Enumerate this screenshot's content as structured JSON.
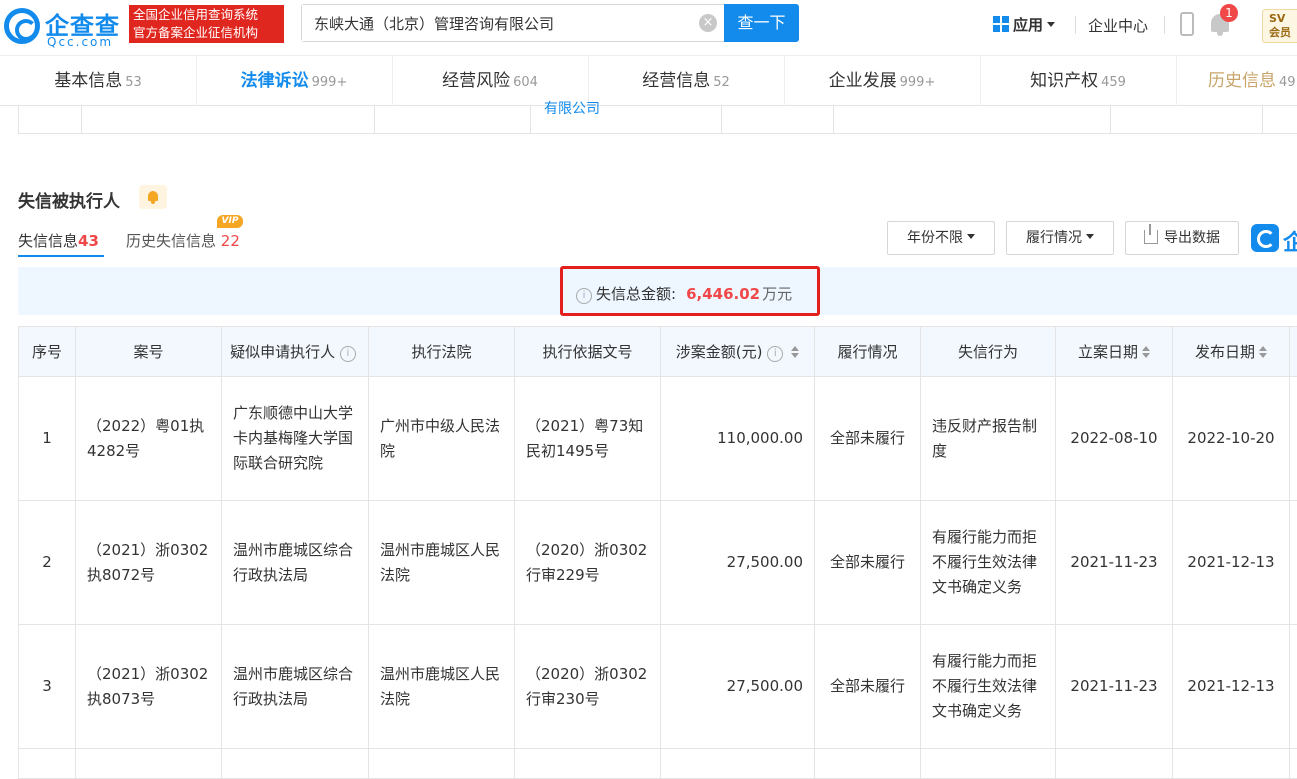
{
  "header": {
    "logo_cn": "企查查",
    "logo_en": "Qcc.com",
    "slogan_line1": "全国企业信用查询系统",
    "slogan_line2": "官方备案企业征信机构",
    "search_value": "东峡大通（北京）管理咨询有限公司",
    "search_button": "查一下",
    "app_label": "应用",
    "enterprise_center": "企业中心",
    "notification_count": "1",
    "vip_chip": "SV",
    "vip_chip_sub": "会员"
  },
  "tabs": [
    {
      "label": "基本信息",
      "count": "53"
    },
    {
      "label": "法律诉讼",
      "count": "999+"
    },
    {
      "label": "经营风险",
      "count": "604"
    },
    {
      "label": "经营信息",
      "count": "52"
    },
    {
      "label": "企业发展",
      "count": "999+"
    },
    {
      "label": "知识产权",
      "count": "459"
    },
    {
      "label": "历史信息",
      "count": "49"
    }
  ],
  "prev_table_text": "有限公司",
  "section": {
    "title": "失信被执行人",
    "subtabs": [
      {
        "label": "失信信息",
        "count": "43"
      },
      {
        "label": "历史失信信息",
        "count": "22"
      }
    ],
    "vip_tag": "VIP",
    "filters": {
      "year": "年份不限",
      "status": "履行情况",
      "export": "导出数据"
    },
    "side_logo_text": "企"
  },
  "summary": {
    "label": "失信总金额:",
    "amount": "6,446.02",
    "unit": "万元"
  },
  "table": {
    "headers": [
      "序号",
      "案号",
      "疑似申请执行人",
      "执行法院",
      "执行依据文号",
      "涉案金额(元)",
      "履行情况",
      "失信行为",
      "立案日期",
      "发布日期"
    ],
    "rows": [
      {
        "index": "1",
        "case_no": "（2022）粤01执4282号",
        "applicant": "广东顺德中山大学卡内基梅隆大学国际联合研究院",
        "court": "广州市中级人民法院",
        "basis_doc": "（2021）粤73知民初1495号",
        "amount": "110,000.00",
        "status": "全部未履行",
        "behavior": "违反财产报告制度",
        "filing_date": "2022-08-10",
        "publish_date": "2022-10-20"
      },
      {
        "index": "2",
        "case_no": "（2021）浙0302执8072号",
        "applicant": "温州市鹿城区综合行政执法局",
        "court": "温州市鹿城区人民法院",
        "basis_doc": "（2020）浙0302行审229号",
        "amount": "27,500.00",
        "status": "全部未履行",
        "behavior": "有履行能力而拒不履行生效法律文书确定义务",
        "filing_date": "2021-11-23",
        "publish_date": "2021-12-13"
      },
      {
        "index": "3",
        "case_no": "（2021）浙0302执8073号",
        "applicant": "温州市鹿城区综合行政执法局",
        "court": "温州市鹿城区人民法院",
        "basis_doc": "（2020）浙0302行审230号",
        "amount": "27,500.00",
        "status": "全部未履行",
        "behavior": "有履行能力而拒不履行生效法律文书确定义务",
        "filing_date": "2021-11-23",
        "publish_date": "2021-12-13"
      }
    ]
  },
  "colors": {
    "brand_blue": "#128bed",
    "highlight_red": "#e3201b",
    "amount_red": "#f04848"
  }
}
